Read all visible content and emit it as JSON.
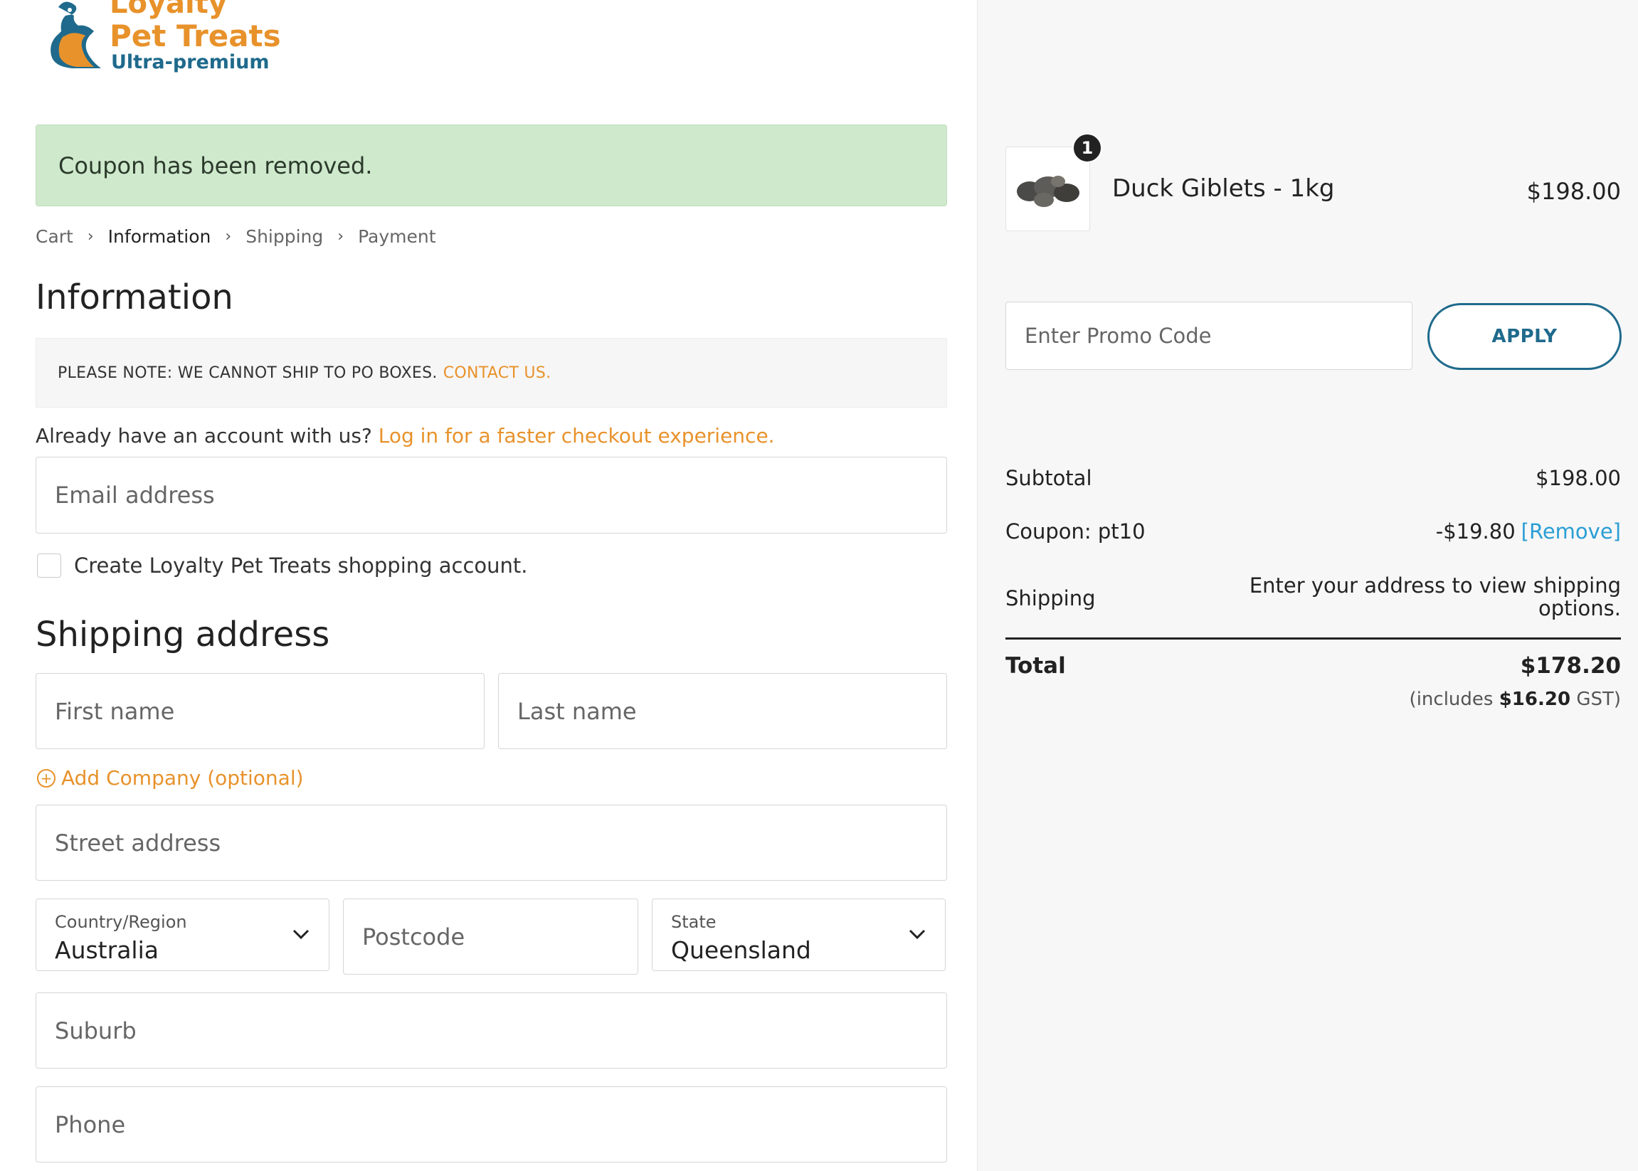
{
  "brand": {
    "line1": "Loyalty",
    "line2": "Pet Treats",
    "line3": "Ultra-premium"
  },
  "notice": {
    "message": "Coupon has been removed."
  },
  "breadcrumb": {
    "items": [
      "Cart",
      "Information",
      "Shipping",
      "Payment"
    ],
    "current": "Information"
  },
  "information": {
    "heading": "Information",
    "po_note": "PLEASE NOTE: WE CANNOT SHIP TO PO BOXES.",
    "po_contact": "CONTACT US.",
    "account_prompt": "Already have an account with us?",
    "login_link": "Log in for a faster checkout experience.",
    "email_placeholder": "Email address",
    "create_account_label": "Create Loyalty Pet Treats shopping account."
  },
  "shipping_address": {
    "heading": "Shipping address",
    "first_name_placeholder": "First name",
    "last_name_placeholder": "Last name",
    "add_company": "Add Company (optional)",
    "street_placeholder": "Street address",
    "country_label": "Country/Region",
    "country_value": "Australia",
    "postcode_placeholder": "Postcode",
    "state_label": "State",
    "state_value": "Queensland",
    "suburb_placeholder": "Suburb",
    "phone_placeholder": "Phone"
  },
  "cart": {
    "item": {
      "name": "Duck Giblets - 1kg",
      "qty": "1",
      "price": "$198.00"
    },
    "promo_placeholder": "Enter Promo Code",
    "apply_label": "APPLY"
  },
  "summary": {
    "subtotal_label": "Subtotal",
    "subtotal_value": "$198.00",
    "coupon_label": "Coupon: pt10",
    "coupon_value": "-$19.80",
    "remove_label": "[Remove]",
    "shipping_label": "Shipping",
    "shipping_line1": "Enter your address to view shipping",
    "shipping_line2": "options.",
    "total_label": "Total",
    "total_value": "$178.20",
    "gst_prefix": "(includes",
    "gst_amount": "$16.20",
    "gst_suffix": "GST)"
  },
  "colors": {
    "accent_orange": "#e8922b",
    "brand_blue": "#1f6a8c",
    "link_blue": "#2a9ed4",
    "success_bg": "#cfe9cc"
  }
}
